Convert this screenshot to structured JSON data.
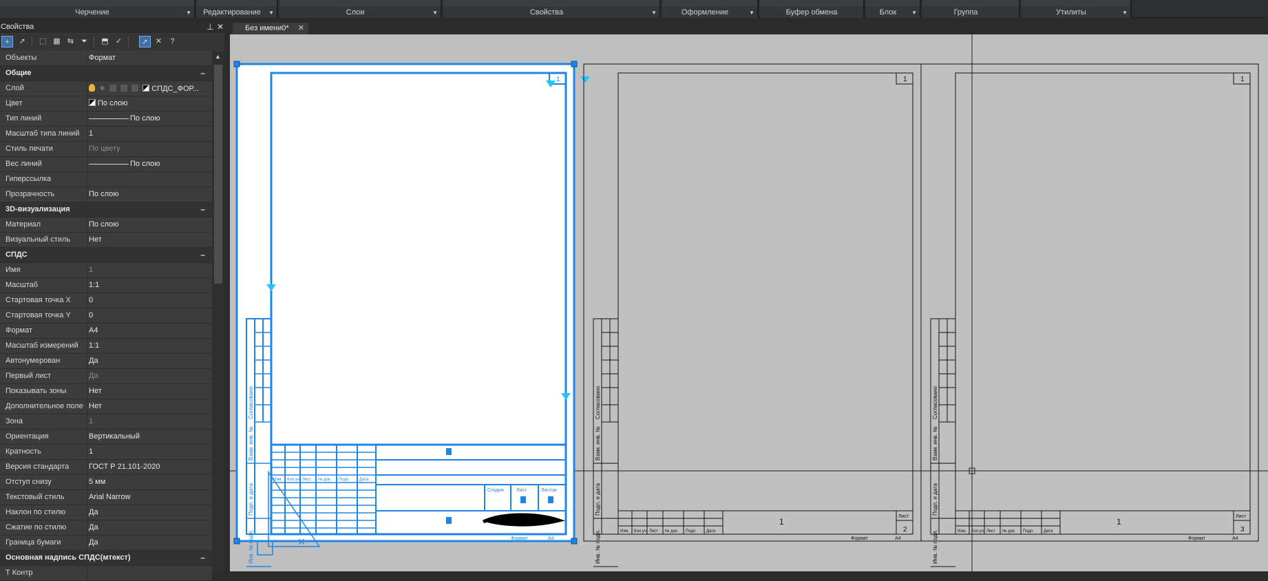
{
  "ribbon": {
    "groups": [
      {
        "label": "Черчение"
      },
      {
        "label": "Редактирование"
      },
      {
        "label": "Слои"
      },
      {
        "label": "Свойства"
      },
      {
        "label": "Оформление"
      },
      {
        "label": "Буфер обмена"
      },
      {
        "label": "Блок"
      },
      {
        "label": "Группа"
      },
      {
        "label": "Утилиты"
      }
    ]
  },
  "properties": {
    "title": "Свойства",
    "objects_key": "Объекты",
    "objects_value": "Формат",
    "sections": [
      {
        "header": "Общие",
        "rows": [
          {
            "k": "Слой",
            "v": "СПДС_ФОР...",
            "kind": "layer"
          },
          {
            "k": "Цвет",
            "v": "По слою",
            "kind": "color"
          },
          {
            "k": "Тип линий",
            "v": "По слою",
            "kind": "line"
          },
          {
            "k": "Масштаб типа линий",
            "v": "1"
          },
          {
            "k": "Стиль печати",
            "v": "По цвету",
            "dim": true
          },
          {
            "k": "Вес линий",
            "v": "По слою",
            "kind": "line"
          },
          {
            "k": "Гиперссылка",
            "v": ""
          },
          {
            "k": "Прозрачность",
            "v": "По слою"
          }
        ]
      },
      {
        "header": "3D-визуализация",
        "rows": [
          {
            "k": "Материал",
            "v": "По слою"
          },
          {
            "k": "Визуальный стиль",
            "v": "Нет"
          }
        ]
      },
      {
        "header": "СПДС",
        "rows": [
          {
            "k": "Имя",
            "v": "1",
            "dim": true
          },
          {
            "k": "Масштаб",
            "v": "1:1"
          },
          {
            "k": "Стартовая точка X",
            "v": "0"
          },
          {
            "k": "Стартовая точка Y",
            "v": "0"
          },
          {
            "k": "Формат",
            "v": "A4"
          },
          {
            "k": "Масштаб измерений",
            "v": "1:1"
          },
          {
            "k": "Автонумерован",
            "v": "Да"
          },
          {
            "k": "Первый лист",
            "v": "Да",
            "dim": true
          },
          {
            "k": "Показывать зоны",
            "v": "Нет"
          },
          {
            "k": "Дополнительное поле",
            "v": "Нет"
          },
          {
            "k": "Зона",
            "v": "1",
            "dim": true
          },
          {
            "k": "Ориентация",
            "v": "Вертикальный"
          },
          {
            "k": "Кратность",
            "v": "1"
          },
          {
            "k": "Версия стандарта",
            "v": "ГОСТ Р 21.101-2020"
          },
          {
            "k": "Отступ снизу",
            "v": "5 мм"
          },
          {
            "k": "Текстовый стиль",
            "v": "Arial Narrow"
          },
          {
            "k": "Наклон по стилю",
            "v": "Да"
          },
          {
            "k": "Сжатие по стилю",
            "v": "Да"
          },
          {
            "k": "Граница бумаги",
            "v": "Да"
          }
        ]
      },
      {
        "header": "Основная надпись СПДС(мтекст)",
        "rows": [
          {
            "k": "Т Контр",
            "v": ""
          }
        ]
      }
    ]
  },
  "document": {
    "tab_label": "Без имени0*",
    "sheets": [
      {
        "sheet_number": "1",
        "stamp_number": "1",
        "sheet_count": "",
        "selected": true
      },
      {
        "sheet_number": "1",
        "stamp_number": "1",
        "sheet_count": "2",
        "selected": false
      },
      {
        "sheet_number": "1",
        "stamp_number": "1",
        "sheet_count": "3",
        "selected": false
      }
    ],
    "side_labels": [
      "Согласовано",
      "Взам. инв. №",
      "Подп. и дата",
      "Инв. № подл."
    ],
    "stamp_cols": [
      "Изм.",
      "Кол.уч.",
      "Лист",
      "№ док.",
      "Подп.",
      "Дата"
    ],
    "sheet_label": "Лист",
    "stage_label": "Стадия",
    "sheets_label": "Листов",
    "format_label": "Формат",
    "format_value": "A4"
  },
  "colors": {
    "selection": "#1f86e8",
    "grip": "#1ec8ff",
    "canvas_bg": "#c0c0c0",
    "paper": "#ffffff"
  }
}
